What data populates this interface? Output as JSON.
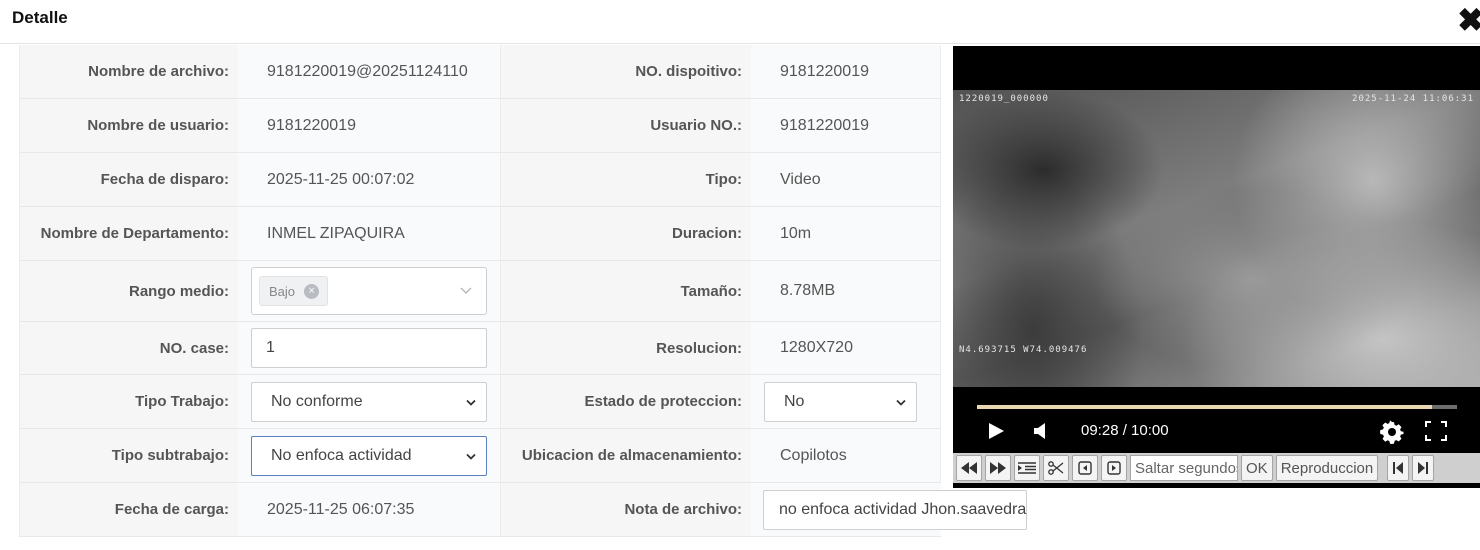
{
  "header": {
    "title": "Detalle",
    "close_glyph": "✖"
  },
  "fields": {
    "nombre_archivo": {
      "label": "Nombre de archivo:",
      "value": "9181220019@20251124110"
    },
    "no_dispositivo": {
      "label": "NO. dispoitivo:",
      "value": "9181220019"
    },
    "nombre_usuario": {
      "label": "Nombre de usuario:",
      "value": "9181220019"
    },
    "usuario_no": {
      "label": "Usuario NO.:",
      "value": "9181220019"
    },
    "fecha_disparo": {
      "label": "Fecha de disparo:",
      "value": "2025-11-25 00:07:02"
    },
    "tipo": {
      "label": "Tipo:",
      "value": "Video"
    },
    "nombre_departamento": {
      "label": "Nombre de Departamento:",
      "value": "INMEL ZIPAQUIRA"
    },
    "duracion": {
      "label": "Duracion:",
      "value": "10m"
    },
    "rango_medio": {
      "label": "Rango medio:",
      "tag": "Bajo",
      "tag_remove_glyph": "×"
    },
    "tamano": {
      "label": "Tamaño:",
      "value": "8.78MB"
    },
    "no_case": {
      "label": "NO. case:",
      "value": "1"
    },
    "resolucion": {
      "label": "Resolucion:",
      "value": "1280X720"
    },
    "tipo_trabajo": {
      "label": "Tipo Trabajo:",
      "value": "No conforme"
    },
    "estado_proteccion": {
      "label": "Estado de proteccion:",
      "value": "No"
    },
    "tipo_subtrabajo": {
      "label": "Tipo subtrabajo:",
      "value": "No enfoca actividad"
    },
    "ubicacion": {
      "label": "Ubicacion de almacenamiento:",
      "value": "Copilotos"
    },
    "fecha_carga": {
      "label": "Fecha de carga:",
      "value": "2025-11-25 06:07:35"
    },
    "nota_archivo": {
      "label": "Nota de archivo:",
      "value": "no enfoca actividad Jhon.saavedra"
    }
  },
  "player": {
    "osd_top_left": "1220019_000000",
    "osd_top_right": "2025-11-24 11:06:31",
    "osd_bottom_left": "N4.693715 W74.009476",
    "time_display": "09:28 / 10:00",
    "progress_fraction": 0.947,
    "icons": {
      "play": "play-icon",
      "volume": "volume-icon",
      "settings": "gear-icon",
      "fullscreen": "fullscreen-icon"
    },
    "toolbar": {
      "rewind": "rewind-icon",
      "forward": "fast-forward-icon",
      "list": "list-icon",
      "cut": "scissors-icon",
      "prev_frame": "prev-frame-icon",
      "next_frame": "next-frame-icon",
      "seek_placeholder": "Saltar segundos",
      "ok_label": "OK",
      "playback_label": "Reproduccion",
      "skip_start": "skip-start-icon",
      "skip_end": "skip-end-icon"
    }
  }
}
